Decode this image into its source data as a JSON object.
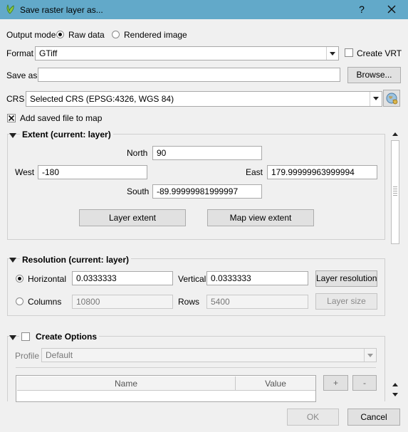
{
  "window": {
    "title": "Save raster layer as...",
    "help_label": "?"
  },
  "output_mode": {
    "label": "Output mode",
    "raw_label": "Raw data",
    "rendered_label": "Rendered image"
  },
  "format": {
    "label": "Format",
    "value": "GTiff",
    "create_vrt_label": "Create VRT"
  },
  "save_as": {
    "label": "Save as",
    "value": "",
    "browse_label": "Browse..."
  },
  "crs": {
    "label": "CRS",
    "value": "Selected CRS (EPSG:4326, WGS 84)"
  },
  "add_saved_file": {
    "label": "Add saved file to map",
    "checked": true
  },
  "extent": {
    "title": "Extent (current: layer)",
    "north_label": "North",
    "north_value": "90",
    "west_label": "West",
    "west_value": "-180",
    "east_label": "East",
    "east_value": "179.99999963999994",
    "south_label": "South",
    "south_value": "-89.99999981999997",
    "layer_extent_label": "Layer extent",
    "map_view_extent_label": "Map view extent"
  },
  "resolution": {
    "title": "Resolution (current: layer)",
    "horizontal_label": "Horizontal",
    "horizontal_value": "0.0333333",
    "vertical_label": "Vertical",
    "vertical_value": "0.0333333",
    "layer_resolution_label": "Layer resolution",
    "columns_label": "Columns",
    "columns_value": "10800",
    "rows_label": "Rows",
    "rows_value": "5400",
    "layer_size_label": "Layer size"
  },
  "create_options": {
    "title": "Create Options",
    "profile_label": "Profile",
    "profile_value": "Default",
    "table_headers": [
      "Name",
      "Value"
    ],
    "add_label": "+",
    "remove_label": "-"
  },
  "footer": {
    "ok_label": "OK",
    "cancel_label": "Cancel"
  },
  "colors": {
    "titlebar": "#62a9c9",
    "background": "#f0f0f0",
    "button": "#e1e1e1"
  }
}
